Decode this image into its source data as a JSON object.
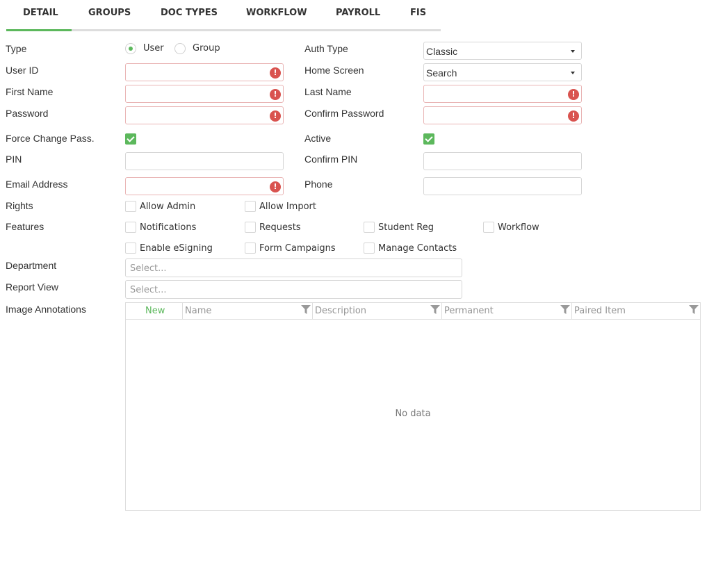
{
  "tabs": [
    {
      "label": "DETAIL",
      "active": true
    },
    {
      "label": "GROUPS"
    },
    {
      "label": "DOC TYPES"
    },
    {
      "label": "WORKFLOW"
    },
    {
      "label": "PAYROLL"
    },
    {
      "label": "FIS"
    }
  ],
  "colors": {
    "accent": "#5cb85c",
    "error": "#d9534f",
    "invalid_border": "#e9b4b4",
    "border": "#d6d6d6"
  },
  "form": {
    "type": {
      "label": "Type",
      "options": [
        "User",
        "Group"
      ],
      "selected": "User"
    },
    "auth_type": {
      "label": "Auth Type",
      "value": "Classic"
    },
    "user_id": {
      "label": "User ID",
      "value": ""
    },
    "home_screen": {
      "label": "Home Screen",
      "value": "Search"
    },
    "first_name": {
      "label": "First Name",
      "value": ""
    },
    "last_name": {
      "label": "Last Name",
      "value": ""
    },
    "password": {
      "label": "Password",
      "value": ""
    },
    "confirm_password": {
      "label": "Confirm Password",
      "value": ""
    },
    "force_change": {
      "label": "Force Change Pass.",
      "checked": true
    },
    "active": {
      "label": "Active",
      "checked": true
    },
    "pin": {
      "label": "PIN",
      "value": ""
    },
    "confirm_pin": {
      "label": "Confirm PIN",
      "value": ""
    },
    "email": {
      "label": "Email Address",
      "value": ""
    },
    "phone": {
      "label": "Phone",
      "value": ""
    },
    "rights": {
      "label": "Rights",
      "options": [
        {
          "label": "Allow Admin",
          "checked": false
        },
        {
          "label": "Allow Import",
          "checked": false
        }
      ]
    },
    "features": {
      "label": "Features",
      "options": [
        {
          "label": "Notifications",
          "checked": false
        },
        {
          "label": "Requests",
          "checked": false
        },
        {
          "label": "Student Reg",
          "checked": false
        },
        {
          "label": "Workflow",
          "checked": false
        },
        {
          "label": "Enable eSigning",
          "checked": false
        },
        {
          "label": "Form Campaigns",
          "checked": false
        },
        {
          "label": "Manage Contacts",
          "checked": false
        }
      ]
    },
    "department": {
      "label": "Department",
      "placeholder": "Select..."
    },
    "report_view": {
      "label": "Report View",
      "placeholder": "Select..."
    },
    "image_annotations": {
      "label": "Image Annotations"
    }
  },
  "error_glyph": "!",
  "grid": {
    "new_label": "New",
    "columns": [
      "Name",
      "Description",
      "Permanent",
      "Paired Item"
    ],
    "empty_text": "No data"
  }
}
